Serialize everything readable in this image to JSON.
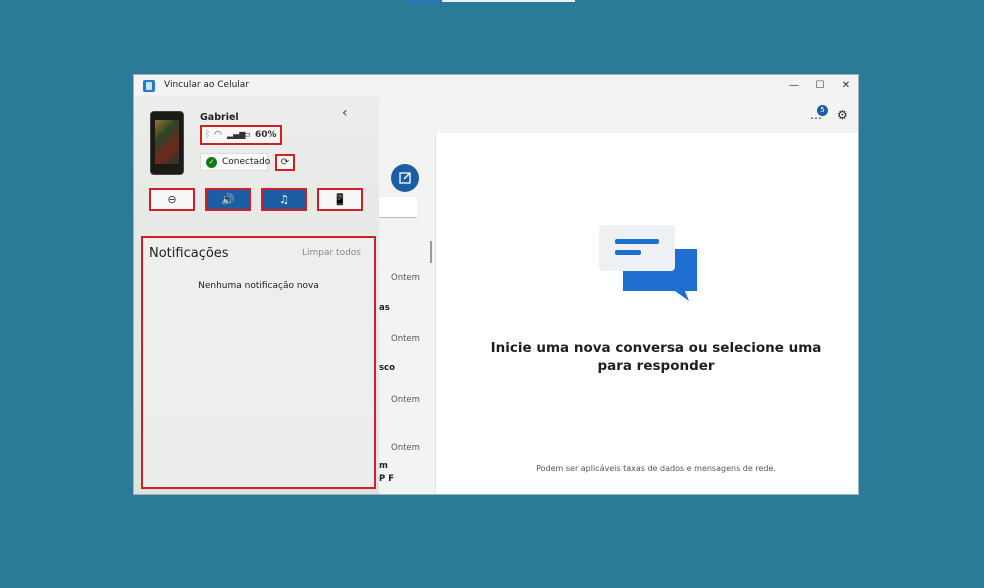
{
  "window": {
    "title": "Vincular ao Celular",
    "controls": [
      "—",
      "☐",
      "✕"
    ]
  },
  "device": {
    "name": "Gabriel",
    "battery": "60%",
    "connection": "Conectado"
  },
  "quick_actions": [
    {
      "name": "do-not-disturb",
      "icon": "⊖",
      "active": false
    },
    {
      "name": "volume",
      "icon": "🔊",
      "active": true
    },
    {
      "name": "music",
      "icon": "♫",
      "active": true
    },
    {
      "name": "phone-audio",
      "icon": "📱",
      "active": false
    }
  ],
  "notifications": {
    "title": "Notificações",
    "clear_all": "Limpar todos",
    "empty": "Nenhuma notificação nova"
  },
  "messages": {
    "dates": [
      "Ontem",
      "Ontem",
      "Ontem",
      "Ontem"
    ],
    "snippets": [
      "as",
      "sco",
      "m",
      "P F"
    ],
    "badge_count": "5",
    "empty_title": "Inicie uma nova conversa ou selecione uma para responder",
    "footnote": "Podem ser aplicáveis taxas de dados e mensagens de rede."
  },
  "colors": {
    "accent": "#1b5ea4",
    "highlight": "#d21f26",
    "background": "#2b7b98"
  }
}
